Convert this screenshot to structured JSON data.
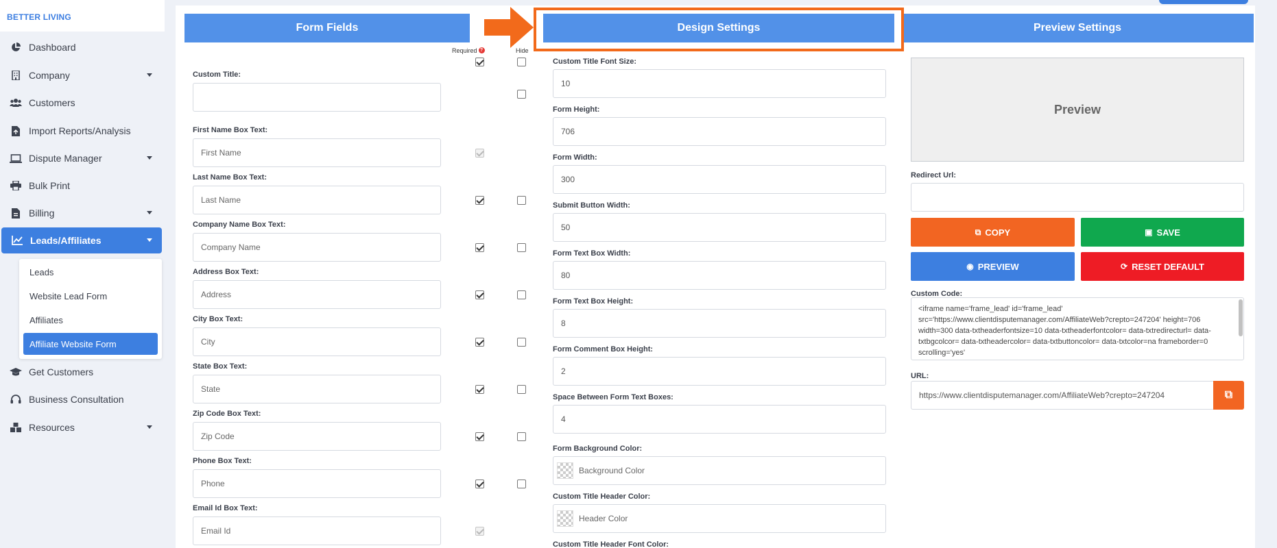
{
  "brand": "BETTER LIVING",
  "nav": [
    {
      "label": "Dashboard",
      "icon": "chart-pie-icon",
      "has_caret": false
    },
    {
      "label": "Company",
      "icon": "building-icon",
      "has_caret": true
    },
    {
      "label": "Customers",
      "icon": "users-icon",
      "has_caret": false
    },
    {
      "label": "Import Reports/Analysis",
      "icon": "file-import-icon",
      "has_caret": false
    },
    {
      "label": "Dispute Manager",
      "icon": "laptop-icon",
      "has_caret": true
    },
    {
      "label": "Bulk Print",
      "icon": "printer-icon",
      "has_caret": false
    },
    {
      "label": "Billing",
      "icon": "billing-icon",
      "has_caret": true
    },
    {
      "label": "Leads/Affiliates",
      "icon": "chart-line-icon",
      "has_caret": true
    },
    {
      "label": "Get Customers",
      "icon": "graduation-cap-icon",
      "has_caret": false
    },
    {
      "label": "Business Consultation",
      "icon": "headset-icon",
      "has_caret": false
    },
    {
      "label": "Resources",
      "icon": "boxes-icon",
      "has_caret": true
    }
  ],
  "submenu": [
    "Leads",
    "Website Lead Form",
    "Affiliates",
    "Affiliate Website Form"
  ],
  "form_fields": {
    "title": "Form Fields",
    "required_label": "Required",
    "hide_label": "Hide",
    "custom_title_label": "Custom Title:",
    "custom_title_value": "",
    "fields": [
      {
        "label": "First Name Box Text:",
        "placeholder": "First Name",
        "required": "disabled",
        "hide": "none"
      },
      {
        "label": "Last Name Box Text:",
        "placeholder": "Last Name",
        "required": "checked",
        "hide": "unchecked"
      },
      {
        "label": "Company Name Box Text:",
        "placeholder": "Company Name",
        "required": "checked",
        "hide": "unchecked"
      },
      {
        "label": "Address Box Text:",
        "placeholder": "Address",
        "required": "checked",
        "hide": "unchecked"
      },
      {
        "label": "City Box Text:",
        "placeholder": "City",
        "required": "checked",
        "hide": "unchecked"
      },
      {
        "label": "State Box Text:",
        "placeholder": "State",
        "required": "checked",
        "hide": "unchecked"
      },
      {
        "label": "Zip Code Box Text:",
        "placeholder": "Zip Code",
        "required": "checked",
        "hide": "unchecked"
      },
      {
        "label": "Phone Box Text:",
        "placeholder": "Phone",
        "required": "checked",
        "hide": "unchecked"
      },
      {
        "label": "Email Id Box Text:",
        "placeholder": "Email Id",
        "required": "disabled",
        "hide": "none"
      }
    ]
  },
  "design": {
    "title": "Design Settings",
    "fields": [
      {
        "label": "Custom Title Font Size:",
        "value": "10"
      },
      {
        "label": "Form Height:",
        "value": "706"
      },
      {
        "label": "Form Width:",
        "value": "300"
      },
      {
        "label": "Submit Button Width:",
        "value": "50"
      },
      {
        "label": "Form Text Box Width:",
        "value": "80"
      },
      {
        "label": "Form Text Box Height:",
        "value": "8"
      },
      {
        "label": "Form Comment Box Height:",
        "value": "2"
      },
      {
        "label": "Space Between Form Text Boxes:",
        "value": "4"
      }
    ],
    "bg_color_label": "Form Background Color:",
    "bg_color_placeholder": "Background Color",
    "header_color_label": "Custom Title Header Color:",
    "header_color_placeholder": "Header Color",
    "header_font_color_label": "Custom Title Header Font Color:"
  },
  "preview": {
    "title": "Preview Settings",
    "preview_text": "Preview",
    "redirect_label": "Redirect Url:",
    "redirect_value": "",
    "copy_label": "COPY",
    "save_label": "SAVE",
    "preview_label": "PREVIEW",
    "reset_label": "RESET DEFAULT",
    "custom_code_label": "Custom Code:",
    "custom_code": "<iframe name='frame_lead' id='frame_lead' src='https://www.clientdisputemanager.com/AffiliateWeb?crepto=247204' height=706 width=300 data-txtheaderfontsize=10 data-txtheaderfontcolor= data-txtredirecturl= data-txtbgcolcor= data-txtheadercolor= data-txtbuttoncolor= data-txtcolor=na frameborder=0  scrolling='yes'",
    "url_label": "URL:",
    "url_value": "https://www.clientdisputemanager.com/AffiliateWeb?crepto=247204"
  },
  "colors": {
    "primary": "#3d7fe0",
    "header": "#5291e8",
    "orange": "#f26522",
    "green": "#10a84e",
    "red": "#ee1c25",
    "annotation": "#f26a1b"
  }
}
